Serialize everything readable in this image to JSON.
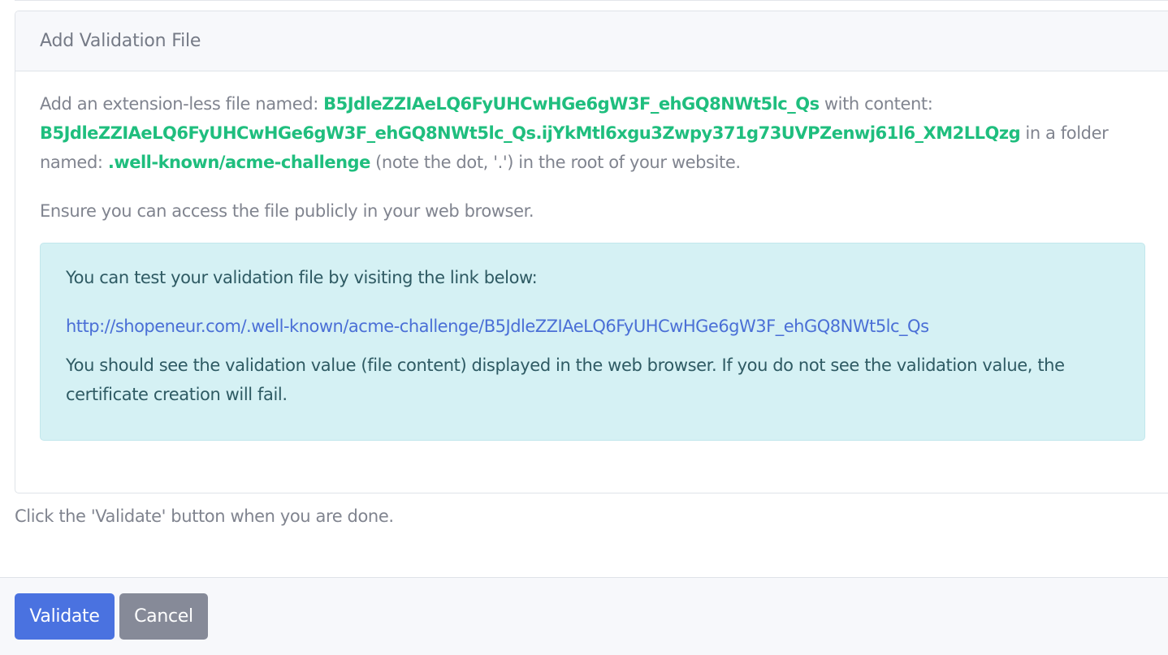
{
  "card": {
    "title": "Add Validation File",
    "p1": {
      "t1": "Add an extension-less file named: ",
      "filename": "B5JdleZZIAeLQ6FyUHCwHGe6gW3F_ehGQ8NWt5lc_Qs",
      "t2": " with content: ",
      "content": "B5JdleZZIAeLQ6FyUHCwHGe6gW3F_ehGQ8NWt5lc_Qs.ijYkMtl6xgu3Zwpy371g73UVPZenwj61l6_XM2LLQzg",
      "t3": " in a folder named: ",
      "folder": ".well-known/acme-challenge",
      "t4": " (note the dot, '.') in the root of your website."
    },
    "p2": "Ensure you can access the file publicly in your web browser.",
    "info": {
      "intro": "You can test your validation file by visiting the link below:",
      "link": "http://shopeneur.com/.well-known/acme-challenge/B5JdleZZIAeLQ6FyUHCwHGe6gW3F_ehGQ8NWt5lc_Qs",
      "note": "You should see the validation value (file content) displayed in the web browser. If you do not see the validation value, the certificate creation will fail."
    }
  },
  "after_text": "Click the 'Validate' button when you are done.",
  "footer": {
    "validate_label": "Validate",
    "cancel_label": "Cancel"
  },
  "colors": {
    "accent_green": "#1fbe7e",
    "primary_blue": "#4a72e0",
    "cancel_gray": "#868a98",
    "info_bg": "#d5f1f4",
    "link_blue": "#4a6fd6"
  }
}
